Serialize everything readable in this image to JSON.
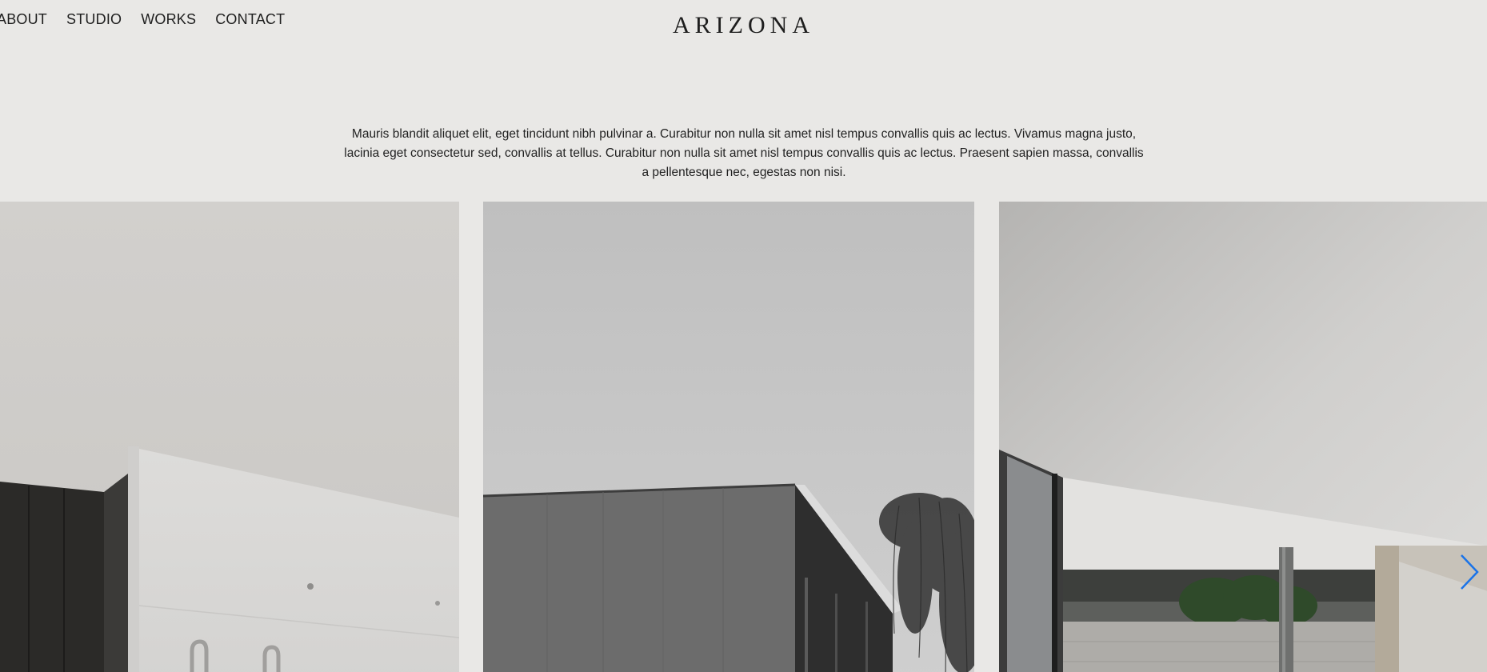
{
  "nav": {
    "items": [
      "ABOUT",
      "STUDIO",
      "WORKS",
      "CONTACT"
    ]
  },
  "brand": {
    "logo": "ARIZONA"
  },
  "intro": {
    "text": "Mauris blandit aliquet elit, eget tincidunt nibh pulvinar a. Curabitur non nulla sit amet nisl tempus convallis quis ac lectus. Vivamus magna justo, lacinia eget consectetur sed, convallis at tellus. Curabitur non nulla sit amet nisl tempus convallis quis ac lectus. Praesent sapien massa, convallis a pellentesque nec, egestas non nisi."
  },
  "gallery": {
    "next_icon": "chevron-right-icon",
    "accent": "#1a73e8"
  }
}
